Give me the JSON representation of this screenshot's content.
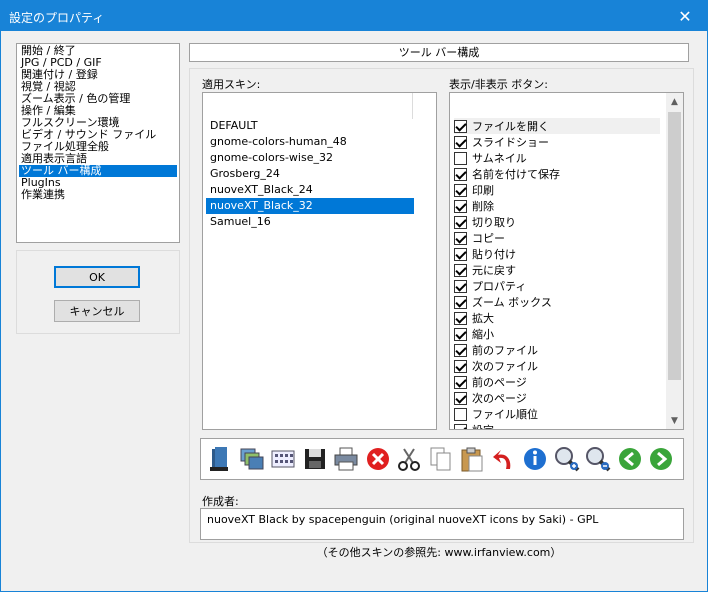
{
  "window": {
    "title": "設定のプロパティ",
    "close_glyph": "✕"
  },
  "nav": {
    "items": [
      "開始 / 終了",
      "JPG / PCD / GIF",
      "関連付け / 登録",
      "視覚 / 視認",
      "ズーム表示 / 色の管理",
      "操作 / 編集",
      "フルスクリーン環境",
      "ビデオ / サウンド ファイル",
      "ファイル処理全般",
      "適用表示言語",
      "ツール バー構成",
      "PlugIns",
      "作業連携"
    ],
    "selected_index": 10
  },
  "buttons": {
    "ok": "OK",
    "cancel": "キャンセル"
  },
  "page_header": "ツール バー構成",
  "skins": {
    "label": "適用スキン:",
    "items": [
      "DEFAULT",
      "gnome-colors-human_48",
      "gnome-colors-wise_32",
      "Grosberg_24",
      "nuoveXT_Black_24",
      "nuoveXT_Black_32",
      "Samuel_16"
    ],
    "selected_index": 5
  },
  "toggles": {
    "label": "表示/非表示 ボタン:",
    "items": [
      {
        "label": "ファイルを開く",
        "checked": true
      },
      {
        "label": "スライドショー",
        "checked": true
      },
      {
        "label": "サムネイル",
        "checked": false
      },
      {
        "label": "名前を付けて保存",
        "checked": true
      },
      {
        "label": "印刷",
        "checked": true
      },
      {
        "label": "削除",
        "checked": true
      },
      {
        "label": "切り取り",
        "checked": true
      },
      {
        "label": "コピー",
        "checked": true
      },
      {
        "label": "貼り付け",
        "checked": true
      },
      {
        "label": "元に戻す",
        "checked": true
      },
      {
        "label": "プロパティ",
        "checked": true
      },
      {
        "label": "ズーム ボックス",
        "checked": true
      },
      {
        "label": "拡大",
        "checked": true
      },
      {
        "label": "縮小",
        "checked": true
      },
      {
        "label": "前のファイル",
        "checked": true
      },
      {
        "label": "次のファイル",
        "checked": true
      },
      {
        "label": "前のページ",
        "checked": true
      },
      {
        "label": "次のページ",
        "checked": true
      },
      {
        "label": "ファイル順位",
        "checked": false
      },
      {
        "label": "設定",
        "checked": true
      }
    ]
  },
  "toolbar_icons": [
    "open-icon",
    "slideshow-icon",
    "thumbnails-icon",
    "save-icon",
    "print-icon",
    "delete-icon",
    "cut-icon",
    "copy-icon",
    "paste-icon",
    "undo-icon",
    "info-icon",
    "zoom-in-icon",
    "zoom-out-icon",
    "previous-icon",
    "next-icon"
  ],
  "author": {
    "label": "作成者:",
    "text": "nuoveXT Black by spacepenguin (original nuoveXT icons by Saki) - GPL"
  },
  "footer": "（その他スキンの参照先: www.irfanview.com）",
  "colors": {
    "titlebar": "#1883d7",
    "selection": "#0078d7",
    "delete": "#e02020",
    "nav_green": "#3aa53a",
    "info_blue": "#1e6fd0"
  }
}
